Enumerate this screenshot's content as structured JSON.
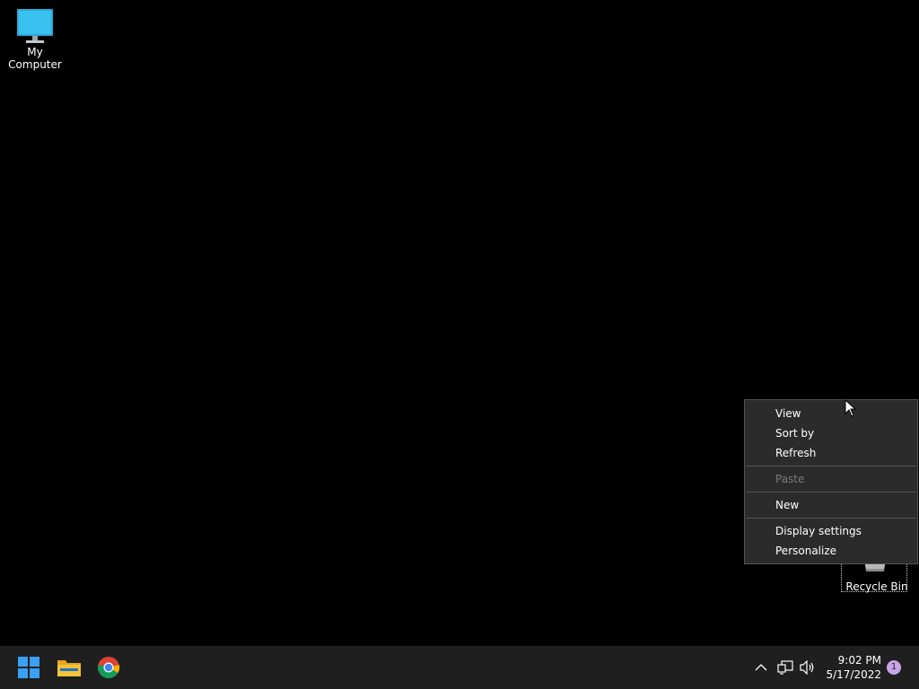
{
  "desktop": {
    "icons": [
      {
        "label": "My Computer",
        "icon": "monitor-icon"
      },
      {
        "label": "Recycle Bin",
        "icon": "recycle-bin-icon"
      }
    ]
  },
  "context_menu": {
    "items": [
      {
        "label": "View",
        "enabled": true
      },
      {
        "label": "Sort by",
        "enabled": true
      },
      {
        "label": "Refresh",
        "enabled": true
      },
      {
        "label": "Paste",
        "enabled": false
      },
      {
        "label": "New",
        "enabled": true
      },
      {
        "label": "Display settings",
        "enabled": true
      },
      {
        "label": "Personalize",
        "enabled": true
      }
    ]
  },
  "taskbar": {
    "apps": [
      {
        "icon": "windows-start-icon"
      },
      {
        "icon": "file-explorer-icon"
      },
      {
        "icon": "chrome-icon"
      }
    ],
    "tray": {
      "icons": [
        "chevron-up-icon",
        "network-icon",
        "volume-icon"
      ],
      "time": "9:02 PM",
      "date": "5/17/2022",
      "notification_count": "1"
    }
  },
  "colors": {
    "desktop_bg": "#000000",
    "taskbar_bg": "#1f1f1f",
    "menu_bg": "#2b2b2b",
    "badge": "#c9a5e6"
  }
}
